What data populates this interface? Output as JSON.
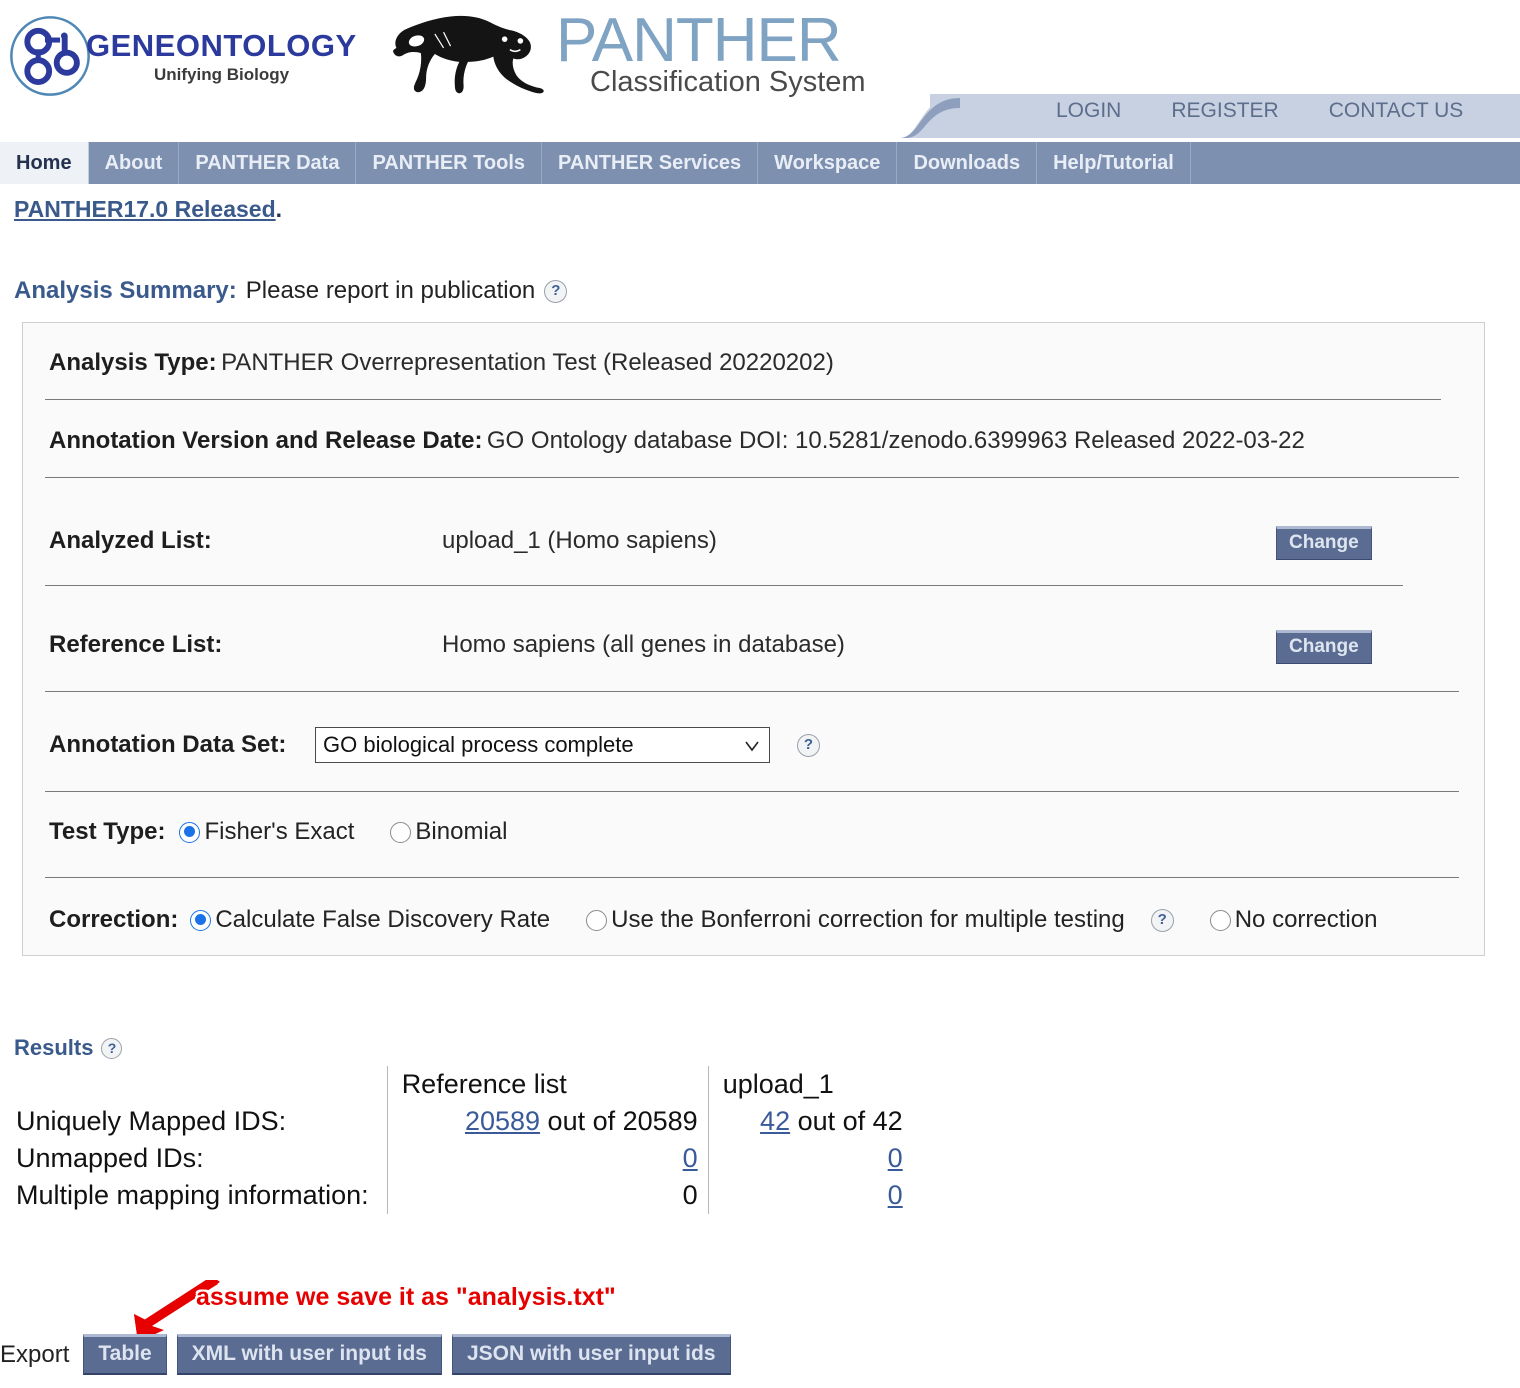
{
  "header": {
    "go_logo": {
      "wordmark": "GENEONTOLOGY",
      "tagline": "Unifying Biology",
      "mark_alt": "go-logo-mark"
    },
    "panther_logo": {
      "wordmark": "PANTHER",
      "subtitle": "Classification System",
      "mark_alt": "panther-silhouette"
    },
    "top_links": [
      "LOGIN",
      "REGISTER",
      "CONTACT US"
    ]
  },
  "nav": {
    "tabs": [
      {
        "label": "Home",
        "active": true
      },
      {
        "label": "About",
        "active": false
      },
      {
        "label": "PANTHER Data",
        "active": false
      },
      {
        "label": "PANTHER Tools",
        "active": false
      },
      {
        "label": "PANTHER Services",
        "active": false
      },
      {
        "label": "Workspace",
        "active": false
      },
      {
        "label": "Downloads",
        "active": false
      },
      {
        "label": "Help/Tutorial",
        "active": false
      }
    ]
  },
  "release": {
    "link_text": "PANTHER17.0 Released",
    "trailing": "."
  },
  "summary": {
    "heading_label": "Analysis Summary:",
    "heading_text": "Please report in publication",
    "help_glyph": "?",
    "analysis_type_label": "Analysis Type:",
    "analysis_type_value": "PANTHER Overrepresentation Test (Released 20220202)",
    "annotation_version_label": "Annotation Version and Release Date:",
    "annotation_version_value": "GO Ontology database DOI: 10.5281/zenodo.6399963 Released 2022-03-22",
    "analyzed_list_label": "Analyzed List:",
    "analyzed_list_value": "upload_1 (Homo sapiens)",
    "analyzed_list_change": "Change",
    "reference_list_label": "Reference List:",
    "reference_list_value": "Homo sapiens (all genes in database)",
    "reference_list_change": "Change",
    "annotation_data_set_label": "Annotation Data Set:",
    "annotation_data_set_value": "GO biological process complete",
    "test_type_label": "Test Type:",
    "test_type_options": [
      {
        "label": "Fisher's Exact",
        "checked": true
      },
      {
        "label": "Binomial",
        "checked": false
      }
    ],
    "correction_label": "Correction:",
    "correction_options": [
      {
        "label": "Calculate False Discovery Rate",
        "checked": true
      },
      {
        "label": "Use the Bonferroni correction for multiple testing",
        "checked": false
      },
      {
        "label": "No correction",
        "checked": false
      }
    ]
  },
  "results": {
    "heading_label": "Results",
    "columns": [
      "",
      "Reference list",
      "upload_1"
    ],
    "rows": [
      {
        "label": "Uniquely Mapped IDS:",
        "reference_link": "20589",
        "reference_rest": " out of 20589",
        "upload_link": "42",
        "upload_rest": " out of 42"
      },
      {
        "label": "Unmapped IDs:",
        "reference_link": "0",
        "reference_rest": "",
        "upload_link": "0",
        "upload_rest": ""
      },
      {
        "label": "Multiple mapping information:",
        "reference_plain": "0",
        "upload_link": "0",
        "upload_rest": ""
      }
    ]
  },
  "annotation": {
    "text": "assume we save it as \"analysis.txt\"",
    "color": "#e60000"
  },
  "export": {
    "label": "Export",
    "buttons": [
      "Table",
      "XML with user input ids",
      "JSON with user input ids"
    ]
  },
  "colors": {
    "nav_bar": "#7e90b0",
    "top_bar": "#c7d1e2",
    "button": "#5a6c92",
    "link": "#3a5a9a",
    "heading": "#3a5a8c",
    "radio_selected": "#1b72e8",
    "annotation_red": "#e60000"
  }
}
